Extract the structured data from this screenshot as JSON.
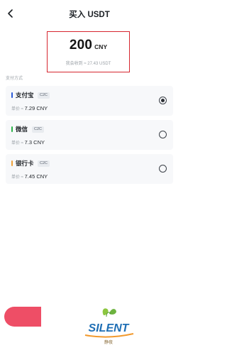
{
  "header": {
    "title": "买入 USDT"
  },
  "order": {
    "amount": "200",
    "currency": "CNY",
    "receive_text": "我会收到 ≈ 27.43 USDT"
  },
  "payment": {
    "section_label": "支付方式",
    "methods": [
      {
        "name": "支付宝",
        "tag": "C2C",
        "price_label": "单价 ≈ ",
        "price": "7.29 CNY",
        "bar_color": "#2b5bd7",
        "selected": true
      },
      {
        "name": "微信",
        "tag": "C2C",
        "price_label": "单价 ≈ ",
        "price": "7.3 CNY",
        "bar_color": "#2bb34a",
        "selected": false
      },
      {
        "name": "银行卡",
        "tag": "C2C",
        "price_label": "单价 ≈ ",
        "price": "7.45 CNY",
        "bar_color": "#f0a23a",
        "selected": false
      }
    ]
  },
  "watermark": {
    "text": "SILENT",
    "sub": "静夜"
  },
  "colors": {
    "accent_red": "#d6262f",
    "button_pink": "#ee4e66",
    "card_bg": "#f7f8fa"
  },
  "icons": {
    "back": "chevron-left-icon"
  }
}
